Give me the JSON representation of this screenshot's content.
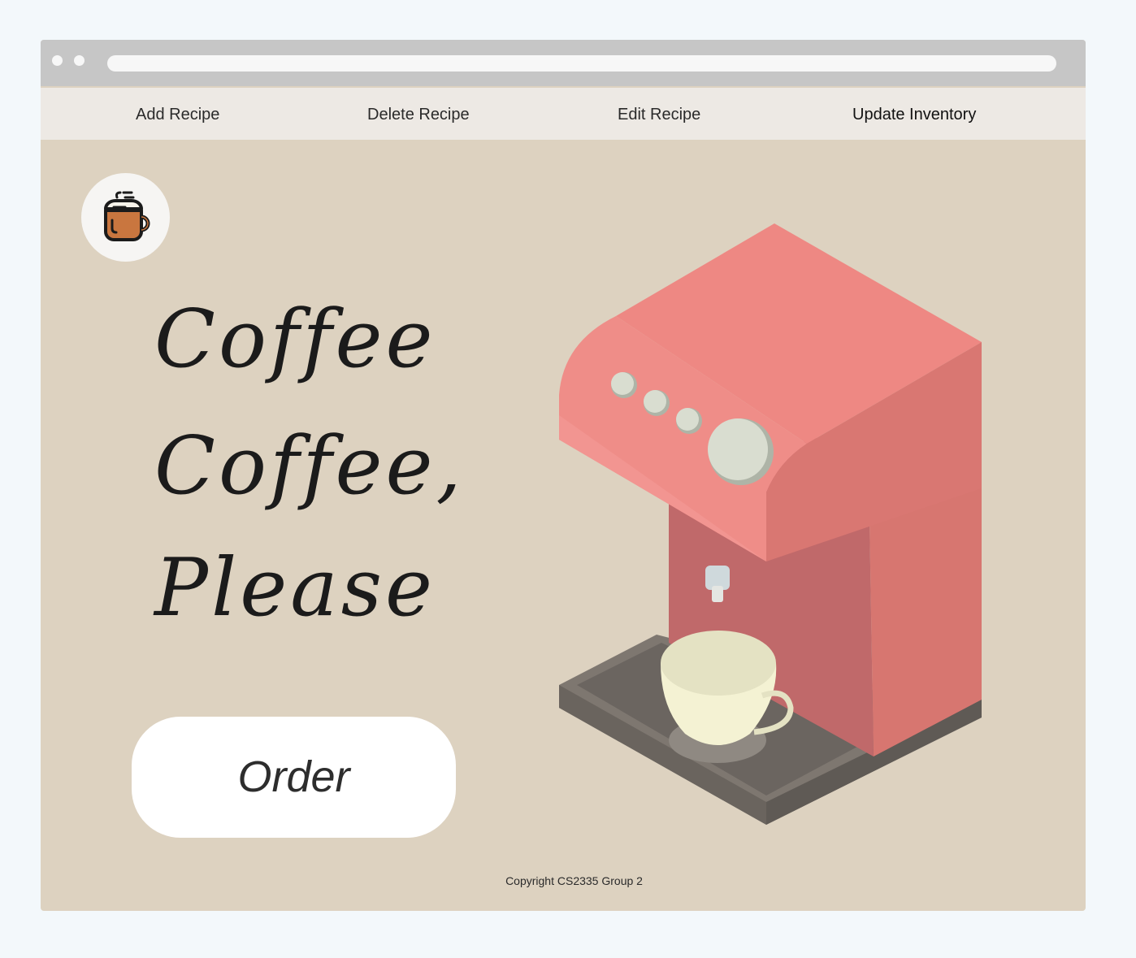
{
  "nav": {
    "items": [
      {
        "label": "Add Recipe"
      },
      {
        "label": "Delete Recipe"
      },
      {
        "label": "Edit Recipe"
      },
      {
        "label": "Update Inventory"
      }
    ]
  },
  "hero": {
    "line1": "Coffee",
    "line2": "Coffee,",
    "line3": "Please"
  },
  "order_button": {
    "label": "Order"
  },
  "footer": {
    "copyright": "Copyright CS2335 Group 2"
  },
  "icons": {
    "logo": "coffee-mug-icon",
    "illustration": "coffee-machine-illustration"
  },
  "colors": {
    "background": "#ddd2c0",
    "navbar": "#ede9e4",
    "machine": "#ef8883",
    "tray": "#6f6963",
    "cup": "#f5f3d4"
  }
}
